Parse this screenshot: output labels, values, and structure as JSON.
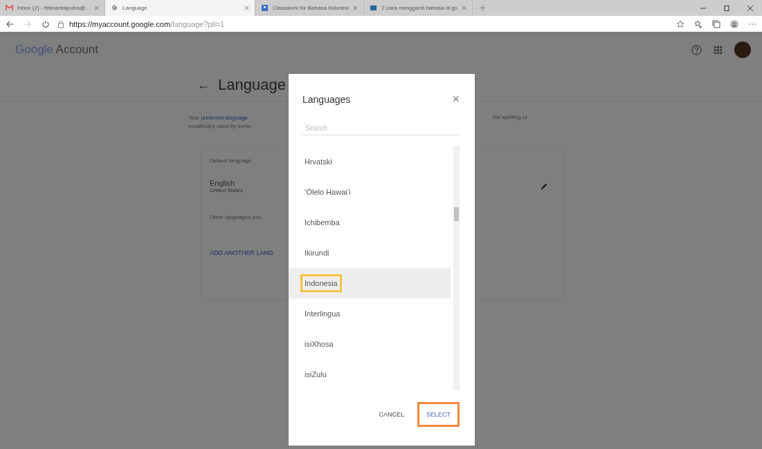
{
  "browser": {
    "tabs": [
      {
        "title": "Inbox (2) - febrianbaputra@...",
        "kind": "mail",
        "selected": false
      },
      {
        "title": "Language",
        "kind": "google",
        "selected": true
      },
      {
        "title": "Classwork for Bahasa Indonesi",
        "kind": "classroom",
        "selected": false
      },
      {
        "title": "2 cara mengganti bahasa di go",
        "kind": "article",
        "selected": false
      }
    ],
    "url_host": "https://myaccount.google.com",
    "url_path": "/language?pli=1"
  },
  "header": {
    "logo": "Google",
    "title": "Account"
  },
  "page": {
    "back": "←",
    "heading": "Language",
    "intro_start": "Your ",
    "intro_link": "preferred language",
    "intro_line2": "vocabulary used by some",
    "intro_right": "the spelling or",
    "card": {
      "default_label": "Default language",
      "language": "English",
      "region": "United States",
      "other_label": "Other languages you",
      "add_button": "ADD ANOTHER LANG"
    }
  },
  "dialog": {
    "title": "Languages",
    "close": "×",
    "search": {
      "placeholder": "Search"
    },
    "items": [
      {
        "label": "Hrvatski",
        "selected": false,
        "highlighted": false
      },
      {
        "label": "ʻŌlelo Hawaiʻi",
        "selected": false,
        "highlighted": false
      },
      {
        "label": "Ichibemba",
        "selected": false,
        "highlighted": false
      },
      {
        "label": "Ikirundi",
        "selected": false,
        "highlighted": false
      },
      {
        "label": "Indonesia",
        "selected": true,
        "highlighted": true
      },
      {
        "label": "Interlingua",
        "selected": false,
        "highlighted": false
      },
      {
        "label": "isiXhosa",
        "selected": false,
        "highlighted": false
      },
      {
        "label": "isiZulu",
        "selected": false,
        "highlighted": false
      }
    ],
    "buttons": [
      {
        "label": "CANCEL",
        "kind": "text",
        "highlighted": false
      },
      {
        "label": "SELECT",
        "kind": "primary",
        "highlighted": true
      }
    ]
  }
}
